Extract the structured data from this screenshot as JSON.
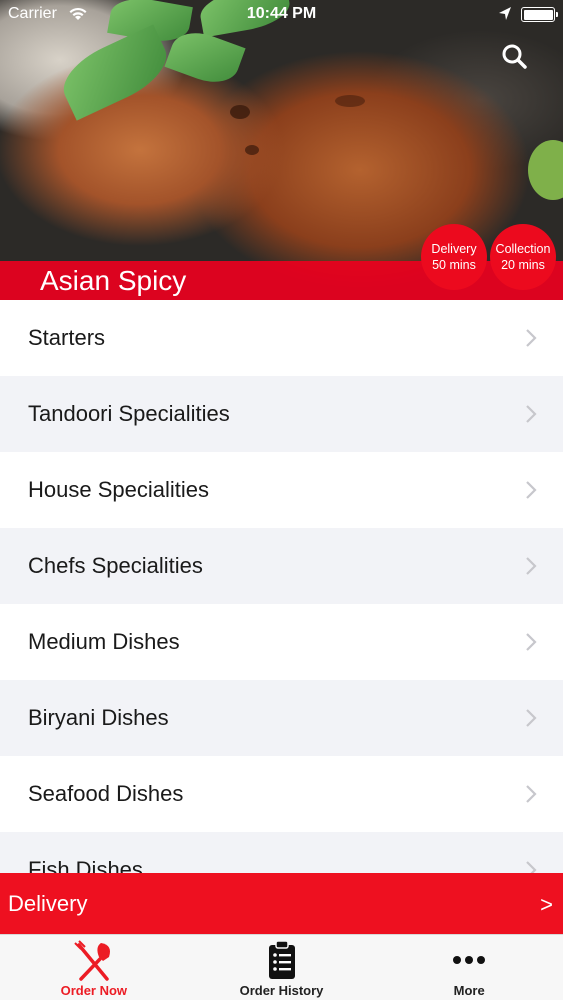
{
  "status_bar": {
    "carrier": "Carrier",
    "time": "10:44 PM"
  },
  "restaurant": {
    "name": "Asian Spicy"
  },
  "badges": {
    "delivery": {
      "line1": "Delivery",
      "line2": "50 mins"
    },
    "collection": {
      "line1": "Collection",
      "line2": "20 mins"
    }
  },
  "menu": {
    "items": [
      {
        "label": "Starters"
      },
      {
        "label": "Tandoori Specialities"
      },
      {
        "label": "House Specialities"
      },
      {
        "label": "Chefs Specialities"
      },
      {
        "label": "Medium Dishes"
      },
      {
        "label": "Biryani Dishes"
      },
      {
        "label": "Seafood Dishes"
      },
      {
        "label": "Fish Dishes"
      }
    ]
  },
  "order_mode": {
    "label": "Delivery",
    "arrow": ">"
  },
  "tabs": [
    {
      "label": "Order Now",
      "icon": "fork-knife-icon",
      "active": true
    },
    {
      "label": "Order History",
      "icon": "clipboard-icon",
      "active": false
    },
    {
      "label": "More",
      "icon": "more-dots-icon",
      "active": false
    }
  ],
  "colors": {
    "accent": "#ec1c24",
    "tab_bg": "#f7f7f7",
    "row_alt": "#f2f3f7"
  }
}
